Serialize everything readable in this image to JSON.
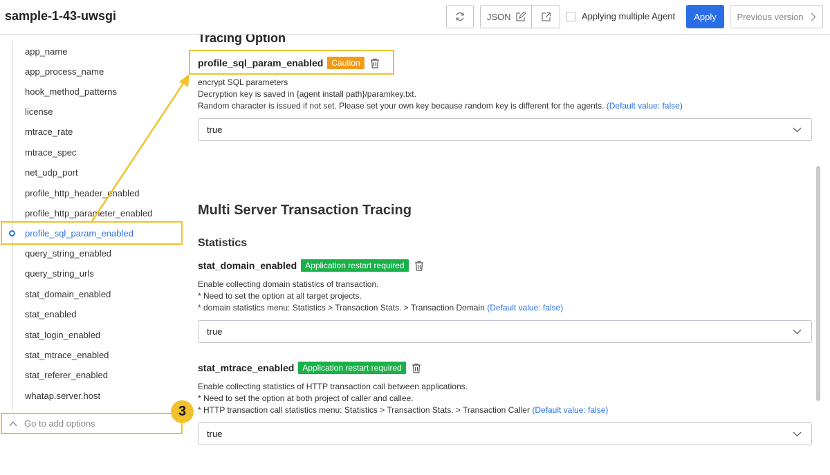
{
  "header": {
    "title": "sample-1-43-uwsgi",
    "json_label": "JSON",
    "multi_agent_label": "Applying multiple Agent",
    "apply_label": "Apply",
    "previous_label": "Previous version"
  },
  "sidebar": {
    "items": [
      {
        "label": "app_name"
      },
      {
        "label": "app_process_name"
      },
      {
        "label": "hook_method_patterns"
      },
      {
        "label": "license"
      },
      {
        "label": "mtrace_rate"
      },
      {
        "label": "mtrace_spec"
      },
      {
        "label": "net_udp_port"
      },
      {
        "label": "profile_http_header_enabled"
      },
      {
        "label": "profile_http_parameter_enabled"
      },
      {
        "label": "profile_sql_param_enabled"
      },
      {
        "label": "query_string_enabled"
      },
      {
        "label": "query_string_urls"
      },
      {
        "label": "stat_domain_enabled"
      },
      {
        "label": "stat_enabled"
      },
      {
        "label": "stat_login_enabled"
      },
      {
        "label": "stat_mtrace_enabled"
      },
      {
        "label": "stat_referer_enabled"
      },
      {
        "label": "whatap.server.host"
      }
    ],
    "active_item": "profile_sql_param_enabled",
    "add_options_label": "Go to add options",
    "step_badge": "3"
  },
  "main": {
    "cut_heading": "Tracing Option",
    "profile_sql": {
      "name": "profile_sql_param_enabled",
      "tag": "Caution",
      "desc1": "encrypt SQL parameters",
      "desc2": "Decryption key is saved in {agent install path}/paramkey.txt.",
      "desc3": "Random character is issued if not set. Please set your own key because random key is different for the agents.",
      "default": "(Default value: false)",
      "value": "true"
    },
    "section_title": "Multi Server Transaction Tracing",
    "sub_title": "Statistics",
    "stat_domain": {
      "name": "stat_domain_enabled",
      "tag": "Application restart required",
      "desc1": "Enable collecting domain statistics of transaction.",
      "desc2": "* Need to set the option at all target projects.",
      "desc3": "* domain statistics menu: Statistics > Transaction Stats. > Transaction Domain",
      "default": "(Default value: false)",
      "value": "true"
    },
    "stat_mtrace": {
      "name": "stat_mtrace_enabled",
      "tag": "Application restart required",
      "desc1": "Enable collecting statistics of HTTP transaction call between applications.",
      "desc2": "* Need to set the option at both project of caller and callee.",
      "desc3": "* HTTP transaction call statistics menu: Statistics > Transaction Stats. > Transaction Caller",
      "default": "(Default value: false)",
      "value": "true"
    }
  },
  "colors": {
    "accent": "#2a6ee6",
    "highlight": "#f2c12e",
    "caution": "#f29a1b",
    "restart": "#1ab14a"
  }
}
